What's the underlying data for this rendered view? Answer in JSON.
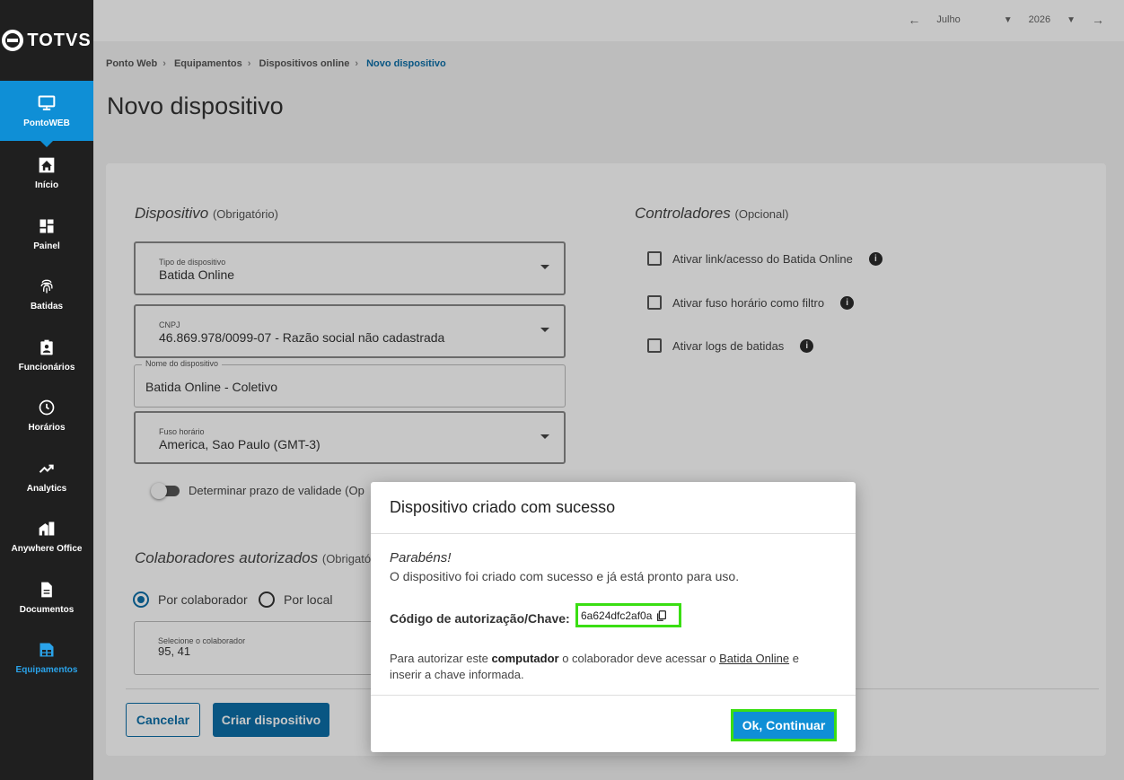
{
  "app": {
    "logo_text": "TOTVS"
  },
  "sidebar": {
    "brand": {
      "label": "PontoWEB",
      "icon": "monitor-icon"
    },
    "items": [
      {
        "label": "Início",
        "icon": "home-icon"
      },
      {
        "label": "Painel",
        "icon": "dashboard-icon"
      },
      {
        "label": "Batidas",
        "icon": "fingerprint-icon"
      },
      {
        "label": "Funcionários",
        "icon": "badge-icon"
      },
      {
        "label": "Horários",
        "icon": "clock-icon"
      },
      {
        "label": "Analytics",
        "icon": "trending-icon"
      },
      {
        "label": "Anywhere Office",
        "icon": "building-icon"
      },
      {
        "label": "Documentos",
        "icon": "document-icon"
      },
      {
        "label": "Equipamentos",
        "icon": "devices-icon"
      }
    ]
  },
  "topbar": {
    "month": "Julho",
    "year": "2026"
  },
  "breadcrumb": [
    "Ponto Web",
    "Equipamentos",
    "Dispositivos online",
    "Novo dispositivo"
  ],
  "page_title": "Novo dispositivo",
  "form": {
    "device_section": {
      "title": "Dispositivo",
      "hint": "(Obrigatório)"
    },
    "device_type": {
      "label": "Tipo de dispositivo",
      "value": "Batida Online"
    },
    "cnpj": {
      "label": "CNPJ",
      "value": "46.869.978/0099-07 - Razão social não cadastrada"
    },
    "device_name": {
      "label": "Nome do dispositivo",
      "value": "Batida Online - Coletivo"
    },
    "timezone": {
      "label": "Fuso horário",
      "value": "America, Sao Paulo (GMT-3)"
    },
    "validity_toggle": "Determinar prazo de validade (Op",
    "collab_section": {
      "title": "Colaboradores autorizados",
      "hint": "(Obrigatório"
    },
    "radio_by_collab": "Por colaborador",
    "radio_by_place": "Por local",
    "collab_select": {
      "label": "Selecione o colaborador",
      "value": "95, 41"
    },
    "cancel": "Cancelar",
    "create": "Criar dispositivo"
  },
  "controllers": {
    "title": "Controladores",
    "hint": "(Opcional)",
    "options": [
      "Ativar link/acesso do Batida Online",
      "Ativar fuso horário como filtro",
      "Ativar logs de batidas"
    ]
  },
  "modal": {
    "title": "Dispositivo criado com sucesso",
    "congrats": "Parabéns!",
    "message": "O dispositivo foi criado com sucesso e já está pronto para uso.",
    "code_label": "Código de autorização/Chave:",
    "code": "6a624dfc2af0a",
    "note_prefix": "Para autorizar este ",
    "note_bold": "computador",
    "note_mid": " o colaborador deve acessar o ",
    "note_link": "Batida Online",
    "note_suffix": " e inserir a chave informada.",
    "ok": "Ok, Continuar"
  }
}
